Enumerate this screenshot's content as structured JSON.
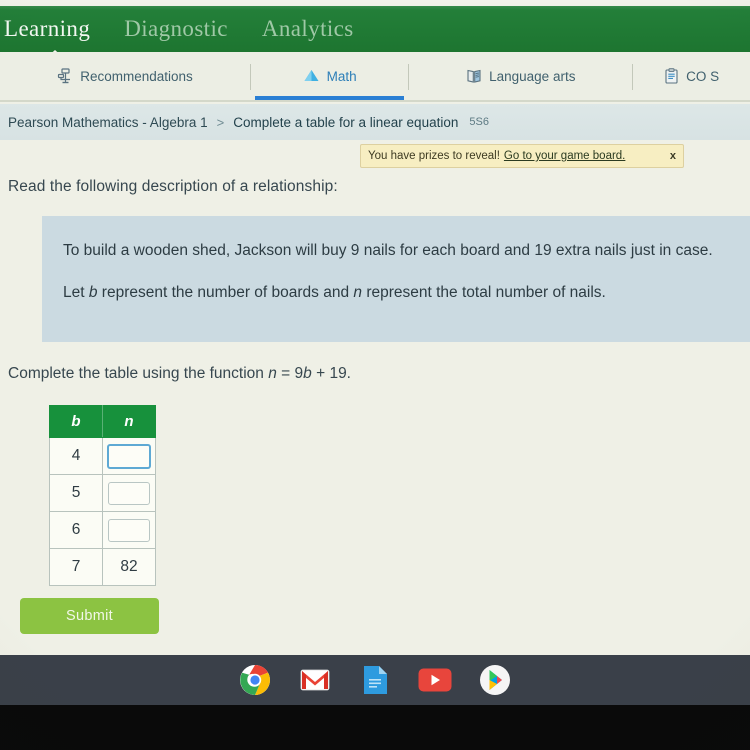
{
  "topnav": {
    "items": [
      {
        "label": "Learning",
        "active": true
      },
      {
        "label": "Diagnostic",
        "active": false
      },
      {
        "label": "Analytics",
        "active": false
      }
    ]
  },
  "tabs": [
    {
      "label": "Recommendations",
      "icon": "recommendations-icon",
      "active": false
    },
    {
      "label": "Math",
      "icon": "math-pyramid-icon",
      "active": true
    },
    {
      "label": "Language arts",
      "icon": "book-icon",
      "active": false
    },
    {
      "label": "CO S",
      "icon": "clipboard-icon",
      "active": false
    }
  ],
  "breadcrumb": {
    "course": "Pearson Mathematics - Algebra 1",
    "separator": ">",
    "skill_name": "Complete a table for a linear equation",
    "skill_code": "5S6"
  },
  "prize_banner": {
    "message": "You have prizes to reveal!",
    "link_text": "Go to your game board.",
    "close_label": "x"
  },
  "question": {
    "intro": "Read the following description of a relationship:",
    "scenario_line1": "To build a wooden shed, Jackson will buy 9 nails for each board and 19 extra nails just in case.",
    "scenario_line2_prefix": "Let ",
    "scenario_var1": "b",
    "scenario_line2_mid": " represent the number of boards and ",
    "scenario_var2": "n",
    "scenario_line2_suffix": " represent the total number of nails.",
    "prompt_prefix": "Complete the table using the function ",
    "prompt_var_n": "n",
    "prompt_eq": " = 9",
    "prompt_var_b": "b",
    "prompt_tail": " + 19."
  },
  "table": {
    "headers": [
      "b",
      "n"
    ],
    "rows": [
      {
        "b": "4",
        "n": "",
        "input": true,
        "focused": true
      },
      {
        "b": "5",
        "n": "",
        "input": true,
        "focused": false
      },
      {
        "b": "6",
        "n": "",
        "input": true,
        "focused": false
      },
      {
        "b": "7",
        "n": "82",
        "input": false,
        "focused": false
      }
    ]
  },
  "submit": {
    "label": "Submit"
  },
  "shelf": {
    "icons": [
      {
        "name": "chrome-icon"
      },
      {
        "name": "gmail-icon"
      },
      {
        "name": "google-docs-icon"
      },
      {
        "name": "youtube-icon"
      },
      {
        "name": "google-play-icon"
      }
    ]
  },
  "colors": {
    "nav_green": "#1f7a32",
    "table_header_green": "#17913c",
    "submit_green": "#8cc342",
    "tab_active_blue": "#2a7fd4",
    "scenario_box": "#cbdae1",
    "banner_yellow": "#f7eec2",
    "page_background": "#eff0e6",
    "shelf_dark": "#3a4049"
  }
}
